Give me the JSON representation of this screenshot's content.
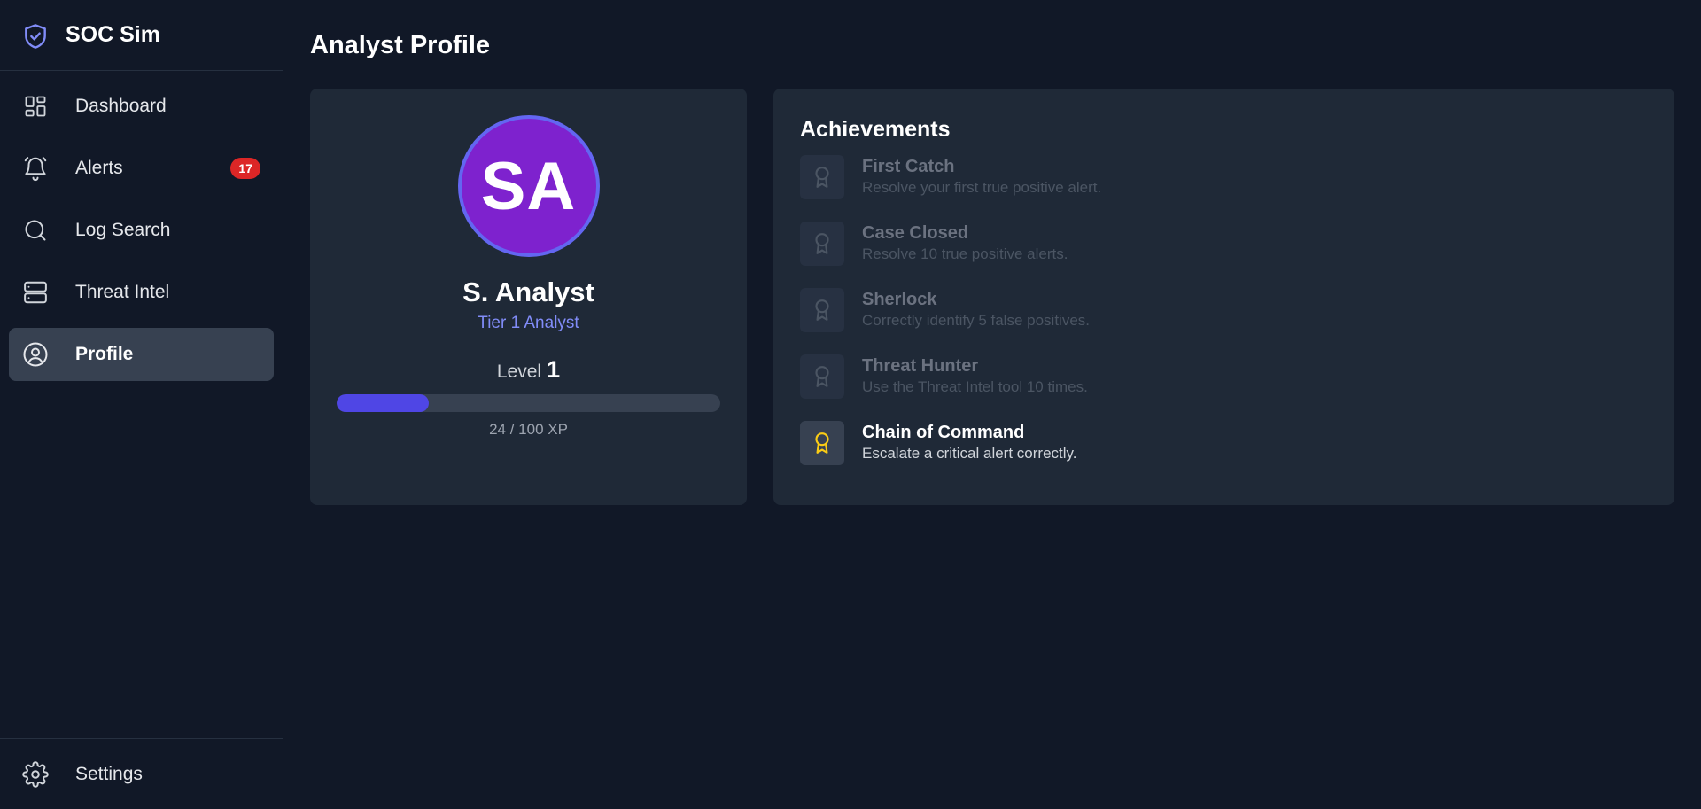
{
  "app": {
    "title": "SOC Sim",
    "brand_icon": "shield-check-icon"
  },
  "sidebar": {
    "items": [
      {
        "label": "Dashboard",
        "icon": "dashboard-icon",
        "active": false
      },
      {
        "label": "Alerts",
        "icon": "bell-icon",
        "active": false,
        "badge": "17"
      },
      {
        "label": "Log Search",
        "icon": "search-icon",
        "active": false
      },
      {
        "label": "Threat Intel",
        "icon": "server-icon",
        "active": false
      },
      {
        "label": "Profile",
        "icon": "user-circle-icon",
        "active": true
      }
    ],
    "settings": {
      "label": "Settings",
      "icon": "gear-icon"
    }
  },
  "page": {
    "title": "Analyst Profile"
  },
  "profile": {
    "initials": "SA",
    "name": "S. Analyst",
    "tier": "Tier 1 Analyst",
    "level_label": "Level",
    "level": "1",
    "xp_current": 24,
    "xp_max": 100,
    "xp_text": "24 / 100 XP"
  },
  "achievements": {
    "title": "Achievements",
    "items": [
      {
        "name": "First Catch",
        "description": "Resolve your first true positive alert.",
        "unlocked": false,
        "icon": "award-icon"
      },
      {
        "name": "Case Closed",
        "description": "Resolve 10 true positive alerts.",
        "unlocked": false,
        "icon": "award-icon"
      },
      {
        "name": "Sherlock",
        "description": "Correctly identify 5 false positives.",
        "unlocked": false,
        "icon": "award-icon"
      },
      {
        "name": "Threat Hunter",
        "description": "Use the Threat Intel tool 10 times.",
        "unlocked": false,
        "icon": "award-icon"
      },
      {
        "name": "Chain of Command",
        "description": "Escalate a critical alert correctly.",
        "unlocked": true,
        "icon": "award-icon"
      }
    ]
  },
  "colors": {
    "background": "#111827",
    "card": "#1f2937",
    "accent": "#4f46e5",
    "avatar": "#7e22ce",
    "badge": "#dc2626",
    "award_unlocked": "#facc15",
    "award_locked": "#4b5563"
  }
}
